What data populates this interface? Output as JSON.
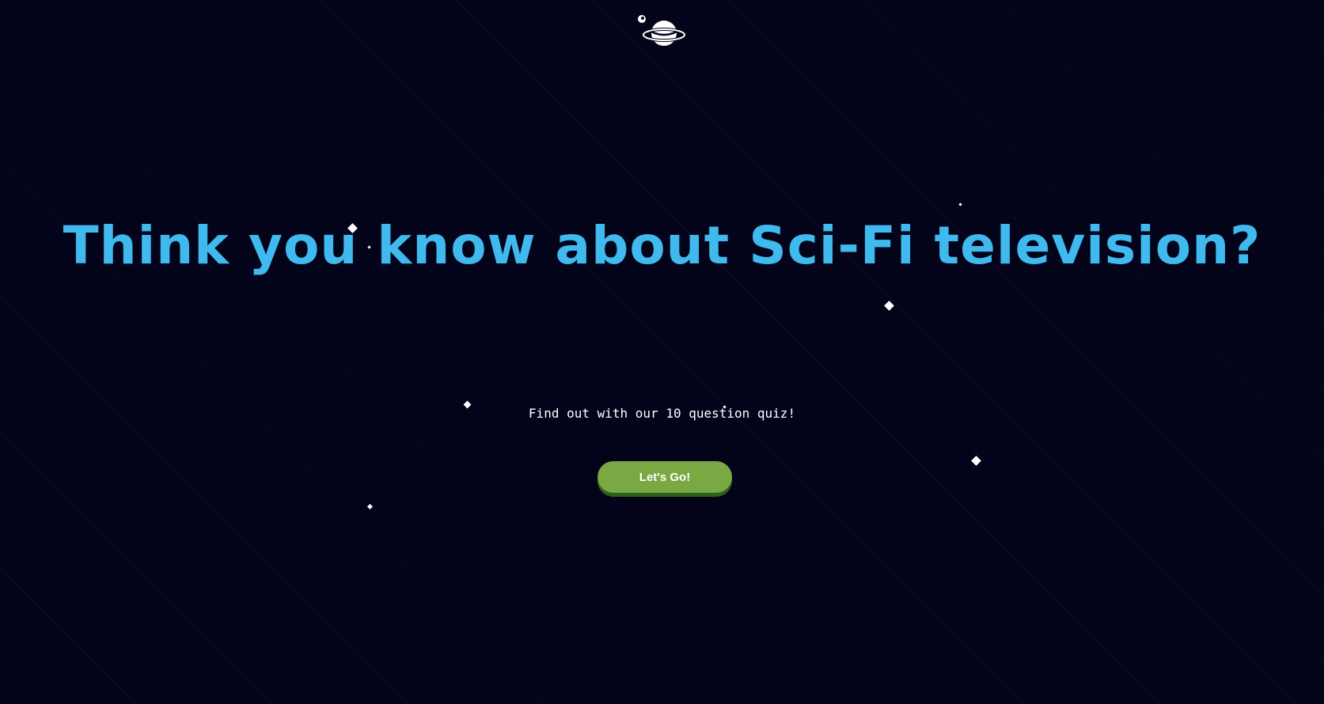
{
  "header": {
    "logo_icon": "planet-icon"
  },
  "hero": {
    "headline": "Think you know about Sci-Fi television?",
    "subtitle": "Find out with our 10 question quiz!",
    "cta_label": "Let's Go!"
  },
  "colors": {
    "background": "#03041a",
    "headline": "#3fb9ee",
    "button": "#7aa843",
    "button_shadow": "#2d5f1e",
    "text": "#ffffff"
  },
  "decorations": {
    "star_icon": "star-icon"
  }
}
